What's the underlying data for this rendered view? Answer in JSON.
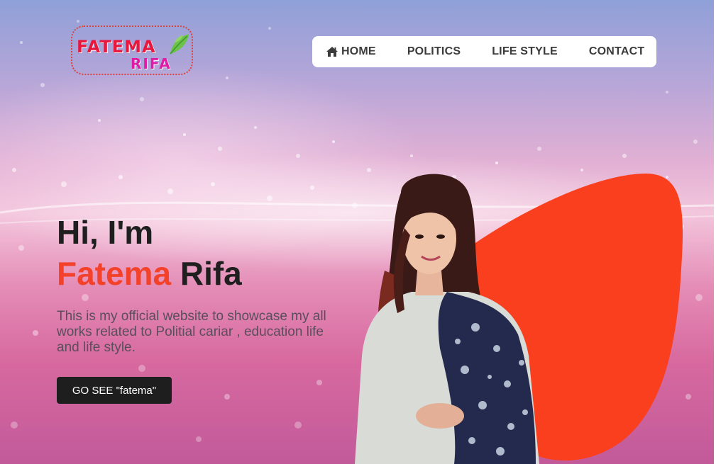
{
  "logo": {
    "line1": "FATEMA",
    "line2": "RIFA"
  },
  "nav": {
    "items": [
      {
        "label": "HOME",
        "icon": "home-icon"
      },
      {
        "label": "POLITICS"
      },
      {
        "label": "LIFE STYLE"
      },
      {
        "label": "CONTACT"
      }
    ]
  },
  "hero": {
    "greeting": "Hi, I'm",
    "first_name": "Fatema",
    "last_name": "Rifa",
    "description": "This is my official website to showcase my all works related to Politial cariar , education life and life style.",
    "cta_label": "GO SEE \"fatema\""
  },
  "colors": {
    "accent": "#f4412a",
    "blob": "#fa3f1f",
    "cta_bg": "#1e1e1e",
    "logo_red": "#e8173d",
    "logo_pink": "#e01ca7"
  }
}
